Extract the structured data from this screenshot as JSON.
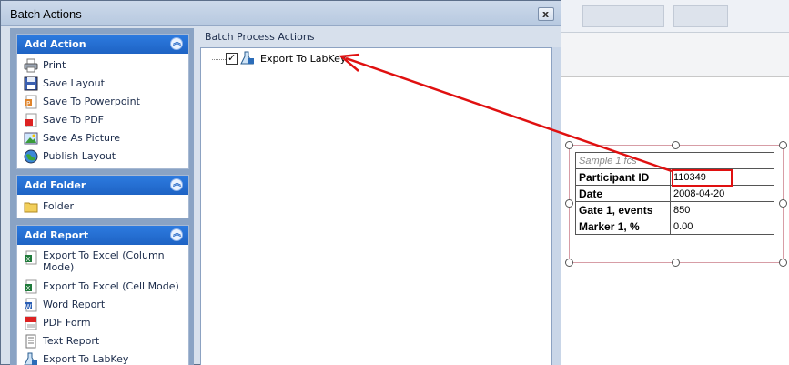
{
  "dialog": {
    "title": "Batch Actions",
    "close_glyph": "x"
  },
  "left_panel": {
    "groups": [
      {
        "title": "Add Action",
        "items": [
          {
            "label": "Print",
            "icon": "printer-icon"
          },
          {
            "label": "Save Layout",
            "icon": "floppy-disk-icon"
          },
          {
            "label": "Save To Powerpoint",
            "icon": "powerpoint-icon"
          },
          {
            "label": "Save To PDF",
            "icon": "pdf-icon"
          },
          {
            "label": "Save As Picture",
            "icon": "picture-icon"
          },
          {
            "label": "Publish Layout",
            "icon": "globe-icon"
          }
        ]
      },
      {
        "title": "Add Folder",
        "items": [
          {
            "label": "Folder",
            "icon": "folder-icon"
          }
        ]
      },
      {
        "title": "Add Report",
        "items": [
          {
            "label": "Export To Excel (Column Mode)",
            "icon": "excel-icon"
          },
          {
            "label": "Export To Excel (Cell Mode)",
            "icon": "excel-icon"
          },
          {
            "label": "Word Report",
            "icon": "word-icon"
          },
          {
            "label": "PDF Form",
            "icon": "pdf-form-icon"
          },
          {
            "label": "Text Report",
            "icon": "text-file-icon"
          },
          {
            "label": "Export To LabKey",
            "icon": "labkey-icon"
          }
        ]
      }
    ]
  },
  "right_panel": {
    "title": "Batch Process Actions",
    "tree_items": [
      {
        "label": "Export To LabKey",
        "checked": true,
        "icon": "labkey-icon"
      }
    ]
  },
  "report": {
    "caption": "Sample 1.fcs",
    "rows": [
      {
        "label": "Participant ID",
        "value": "110349"
      },
      {
        "label": "Date",
        "value": "2008-04-20"
      },
      {
        "label": "Gate 1, events",
        "value": "850"
      },
      {
        "label": "Marker 1, %",
        "value": "0.00"
      }
    ]
  },
  "colors": {
    "group_header": "#1e63c4",
    "panel_bg": "#8aa3c4",
    "annotation_red": "#e01010",
    "report_border": "#d79da6"
  }
}
